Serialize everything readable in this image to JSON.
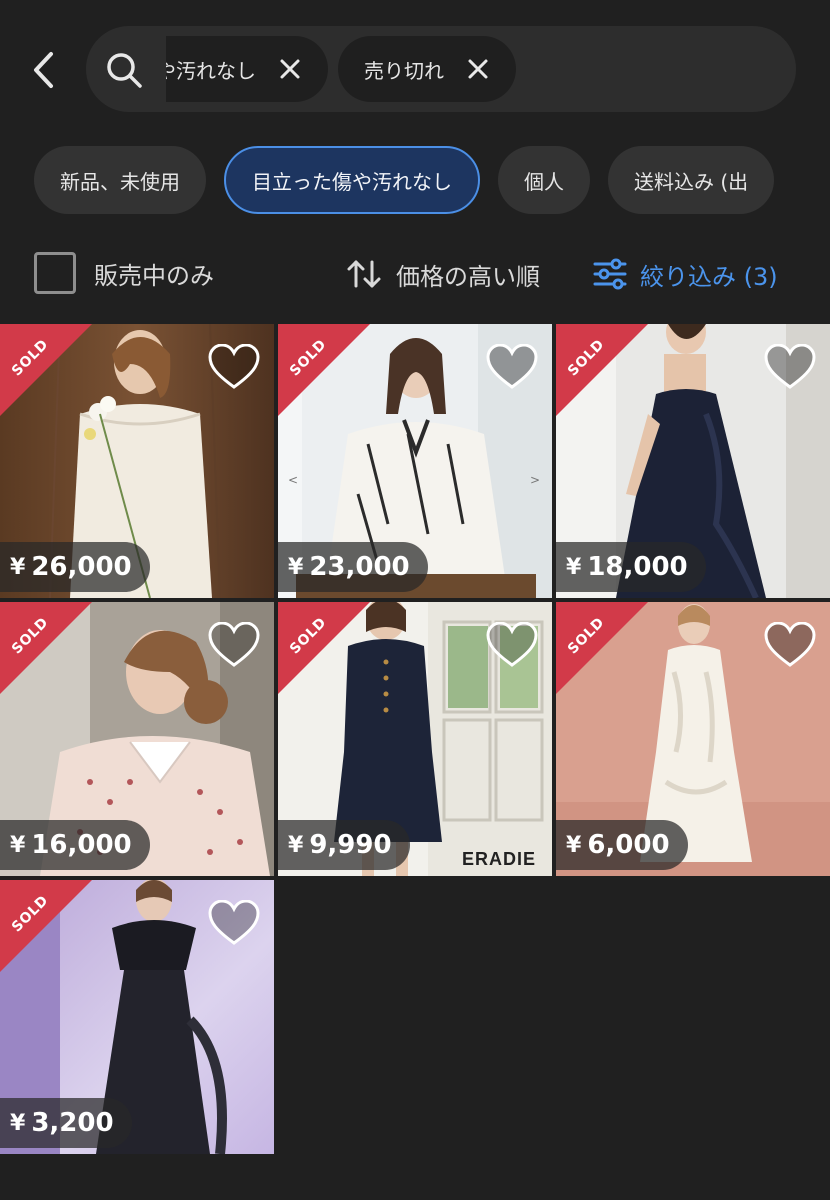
{
  "search": {
    "chips": [
      {
        "label": "や汚れなし"
      },
      {
        "label": "売り切れ"
      }
    ]
  },
  "filters": [
    {
      "label": "新品、未使用",
      "active": false
    },
    {
      "label": "目立った傷や汚れなし",
      "active": true
    },
    {
      "label": "個人",
      "active": false
    },
    {
      "label": "送料込み (出",
      "active": false
    }
  ],
  "options": {
    "on_sale_only_label": "販売中のみ",
    "sort_label": "価格の高い順",
    "filter_label": "絞り込み (3)"
  },
  "colors": {
    "background": "#202020",
    "accent_blue": "#4b94ec",
    "sold_red": "#d23a49"
  },
  "products": [
    {
      "currency": "¥",
      "price": "26,000",
      "sold": true,
      "sold_label": "SOLD",
      "brand": ""
    },
    {
      "currency": "¥",
      "price": "23,000",
      "sold": true,
      "sold_label": "SOLD",
      "brand": ""
    },
    {
      "currency": "¥",
      "price": "18,000",
      "sold": true,
      "sold_label": "SOLD",
      "brand": ""
    },
    {
      "currency": "¥",
      "price": "16,000",
      "sold": true,
      "sold_label": "SOLD",
      "brand": ""
    },
    {
      "currency": "¥",
      "price": "9,990",
      "sold": true,
      "sold_label": "SOLD",
      "brand": "ERADIE"
    },
    {
      "currency": "¥",
      "price": "6,000",
      "sold": true,
      "sold_label": "SOLD",
      "brand": ""
    },
    {
      "currency": "¥",
      "price": "3,200",
      "sold": true,
      "sold_label": "SOLD",
      "brand": ""
    }
  ]
}
